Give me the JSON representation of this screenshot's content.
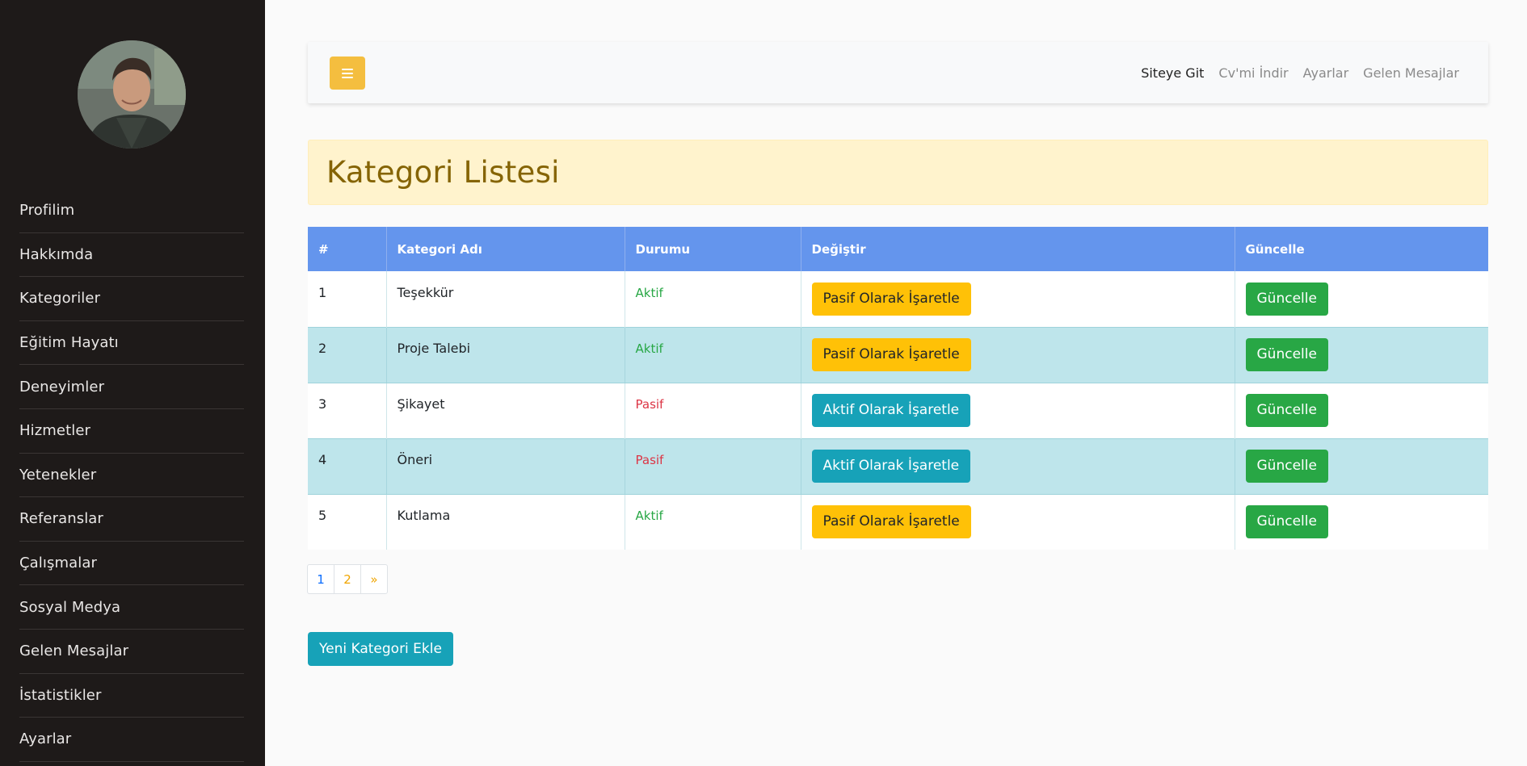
{
  "sidebar": {
    "items": [
      {
        "label": "Profilim"
      },
      {
        "label": "Hakkımda"
      },
      {
        "label": "Kategoriler"
      },
      {
        "label": "Eğitim Hayatı"
      },
      {
        "label": "Deneyimler"
      },
      {
        "label": "Hizmetler"
      },
      {
        "label": "Yetenekler"
      },
      {
        "label": "Referanslar"
      },
      {
        "label": "Çalışmalar"
      },
      {
        "label": "Sosyal Medya"
      },
      {
        "label": "Gelen Mesajlar"
      },
      {
        "label": "İstatistikler"
      },
      {
        "label": "Ayarlar"
      }
    ]
  },
  "topnav": {
    "site": "Siteye Git",
    "cv": "Cv'mi İndir",
    "settings": "Ayarlar",
    "messages": "Gelen Mesajlar"
  },
  "page": {
    "title": "Kategori Listesi"
  },
  "table": {
    "headers": {
      "id": "#",
      "name": "Kategori Adı",
      "status": "Durumu",
      "change": "Değiştir",
      "update": "Güncelle"
    },
    "rows": [
      {
        "id": "1",
        "name": "Teşekkür",
        "status": "Aktif",
        "change": "Pasif Olarak İşaretle",
        "update": "Güncelle"
      },
      {
        "id": "2",
        "name": "Proje Talebi",
        "status": "Aktif",
        "change": "Pasif Olarak İşaretle",
        "update": "Güncelle"
      },
      {
        "id": "3",
        "name": "Şikayet",
        "status": "Pasif",
        "change": "Aktif Olarak İşaretle",
        "update": "Güncelle"
      },
      {
        "id": "4",
        "name": "Öneri",
        "status": "Pasif",
        "change": "Aktif Olarak İşaretle",
        "update": "Güncelle"
      },
      {
        "id": "5",
        "name": "Kutlama",
        "status": "Aktif",
        "change": "Pasif Olarak İşaretle",
        "update": "Güncelle"
      }
    ]
  },
  "pagination": {
    "page1": "1",
    "page2": "2",
    "next": "»"
  },
  "actions": {
    "add_category": "Yeni Kategori Ekle"
  },
  "icons": {
    "toggle": "bars-icon",
    "avatar": "profile-photo"
  },
  "colors": {
    "sidebar_bg": "#1e1a19",
    "toggle_bg": "#f4be3f",
    "table_header": "#6495ed",
    "row_striped": "#bee5eb",
    "warning": "#ffc107",
    "info": "#17a2b8",
    "success": "#28a745",
    "title_bg": "#fff3cd",
    "title_text": "#856404"
  }
}
